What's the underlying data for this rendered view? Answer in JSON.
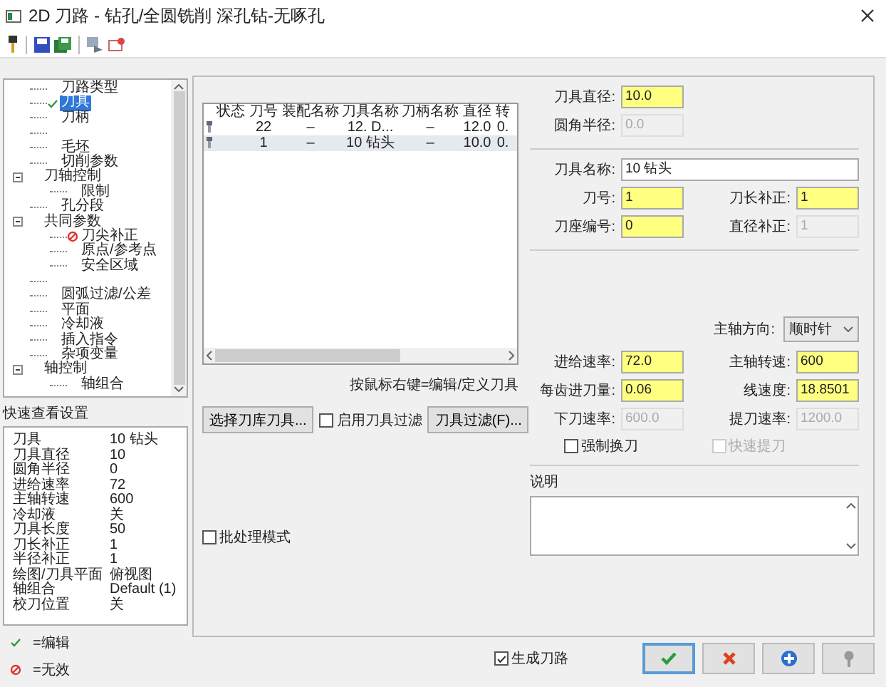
{
  "window": {
    "title": "2D 刀路 - 钻孔/全圆铣削 深孔钻-无啄孔"
  },
  "tree": [
    {
      "kind": "item",
      "label": "刀路类型",
      "edited": false,
      "invalid": false,
      "selected": false
    },
    {
      "kind": "item",
      "label": "刀具",
      "edited": true,
      "invalid": false,
      "selected": true
    },
    {
      "kind": "item",
      "label": "刀柄",
      "edited": false,
      "invalid": false,
      "selected": false
    },
    {
      "kind": "blank"
    },
    {
      "kind": "item",
      "label": "毛坯",
      "edited": false,
      "invalid": false,
      "selected": false
    },
    {
      "kind": "item",
      "label": "切削参数",
      "edited": false,
      "invalid": false,
      "selected": false
    },
    {
      "kind": "item",
      "label": "刀轴控制",
      "edited": false,
      "invalid": false,
      "selected": false,
      "expanded": true,
      "children": [
        {
          "kind": "item",
          "label": "限制",
          "edited": false,
          "invalid": false,
          "selected": false
        }
      ]
    },
    {
      "kind": "item",
      "label": "孔分段",
      "edited": false,
      "invalid": false,
      "selected": false
    },
    {
      "kind": "item",
      "label": "共同参数",
      "edited": false,
      "invalid": false,
      "selected": false,
      "expanded": true,
      "children": [
        {
          "kind": "item",
          "label": "刀尖补正",
          "edited": false,
          "invalid": true,
          "selected": false
        },
        {
          "kind": "item",
          "label": "原点/参考点",
          "edited": false,
          "invalid": false,
          "selected": false
        },
        {
          "kind": "item",
          "label": "安全区域",
          "edited": false,
          "invalid": false,
          "selected": false
        }
      ]
    },
    {
      "kind": "blank"
    },
    {
      "kind": "item",
      "label": "圆弧过滤/公差",
      "edited": false,
      "invalid": false,
      "selected": false
    },
    {
      "kind": "item",
      "label": "平面",
      "edited": false,
      "invalid": false,
      "selected": false
    },
    {
      "kind": "item",
      "label": "冷却液",
      "edited": false,
      "invalid": false,
      "selected": false
    },
    {
      "kind": "item",
      "label": "插入指令",
      "edited": false,
      "invalid": false,
      "selected": false
    },
    {
      "kind": "item",
      "label": "杂项变量",
      "edited": false,
      "invalid": false,
      "selected": false
    },
    {
      "kind": "item",
      "label": "轴控制",
      "edited": false,
      "invalid": false,
      "selected": false,
      "expanded": true,
      "children": [
        {
          "kind": "item",
          "label": "轴组合",
          "edited": false,
          "invalid": false,
          "selected": false
        }
      ]
    }
  ],
  "quick_view": {
    "title": "快速查看设置",
    "rows": [
      {
        "name": "刀具",
        "value": "10 钻头"
      },
      {
        "name": "刀具直径",
        "value": "10"
      },
      {
        "name": "圆角半径",
        "value": "0"
      },
      {
        "name": "进给速率",
        "value": "72"
      },
      {
        "name": "主轴转速",
        "value": "600"
      },
      {
        "name": "冷却液",
        "value": "关"
      },
      {
        "name": "刀具长度",
        "value": "50"
      },
      {
        "name": "刀长补正",
        "value": "1"
      },
      {
        "name": "半径补正",
        "value": "1"
      },
      {
        "name": "绘图/刀具平面",
        "value": "俯视图"
      },
      {
        "name": "轴组合",
        "value": "Default (1)"
      },
      {
        "name": "校刀位置",
        "value": "关"
      }
    ]
  },
  "legend": [
    {
      "kind": "edit",
      "label": "=编辑"
    },
    {
      "kind": "invalid",
      "label": "=无效"
    }
  ],
  "tool_table": {
    "columns": [
      "状态",
      "刀号",
      "装配名称",
      "刀具名称",
      "刀柄名称",
      "直径",
      "转"
    ],
    "rows": [
      {
        "selected": false,
        "cells": [
          "",
          "22",
          "–",
          "12. D...",
          "–",
          "12.0",
          "0."
        ]
      },
      {
        "selected": true,
        "cells": [
          "",
          "1",
          "–",
          "10 钻头",
          "–",
          "10.0",
          "0."
        ]
      }
    ]
  },
  "hint": "按鼠标右键=编辑/定义刀具",
  "select_library_button": "选择刀库刀具...",
  "filter_checkbox": {
    "label": "启用刀具过滤",
    "checked": false
  },
  "filter_button": "刀具过滤(F)...",
  "batch_checkbox": {
    "label": "批处理模式",
    "checked": false
  },
  "diameter_fields": [
    {
      "label": "刀具直径:",
      "value": "10.0",
      "disabled": false
    },
    {
      "label": "圆角半径:",
      "value": "0.0",
      "disabled": true
    }
  ],
  "tool_name": {
    "label": "刀具名称:",
    "value": "10 钻头"
  },
  "number_fields": [
    {
      "label": "刀号:",
      "value": "1",
      "disabled": false
    },
    {
      "label": "刀长补正:",
      "value": "1",
      "disabled": false
    },
    {
      "label": "刀座编号:",
      "value": "0",
      "disabled": false
    },
    {
      "label": "直径补正:",
      "value": "1",
      "disabled": true
    }
  ],
  "spindle_direction": {
    "label": "主轴方向:",
    "value": "顺时针"
  },
  "speed_fields": [
    {
      "label": "进给速率:",
      "value": "72.0",
      "disabled": false
    },
    {
      "label": "主轴转速:",
      "value": "600",
      "disabled": false
    },
    {
      "label": "每齿进刀量:",
      "value": "0.06",
      "disabled": false
    },
    {
      "label": "线速度:",
      "value": "18.8501",
      "disabled": false
    },
    {
      "label": "下刀速率:",
      "value": "600.0",
      "disabled": true
    },
    {
      "label": "提刀速率:",
      "value": "1200.0",
      "disabled": true
    }
  ],
  "option_checks": [
    {
      "label": "强制换刀",
      "checked": false,
      "disabled": false
    },
    {
      "label": "快速提刀",
      "checked": false,
      "disabled": true
    }
  ],
  "notes": {
    "label": "说明"
  },
  "generate_checkbox": {
    "label": "生成刀路",
    "checked": true
  }
}
